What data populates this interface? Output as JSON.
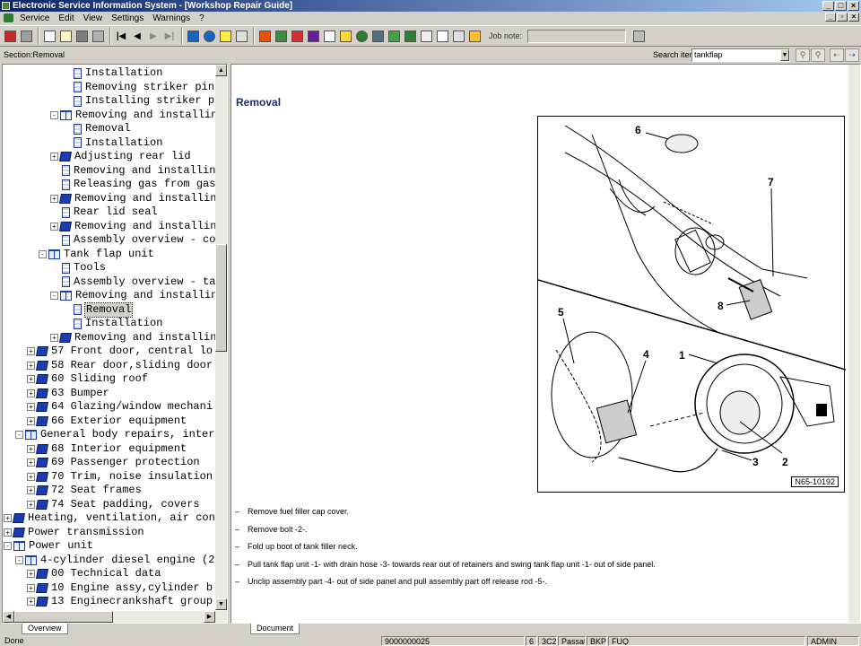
{
  "window": {
    "title": "Electronic Service Information System - [Workshop Repair Guide]"
  },
  "menu": [
    "Service",
    "Edit",
    "View",
    "Settings",
    "Warnings",
    "?"
  ],
  "toolbar": {
    "job_note_label": "Job note:",
    "job_note_value": ""
  },
  "sectionbar": {
    "section_label": "Section:Removal",
    "search_label": "Search item:",
    "search_value": "tankflap"
  },
  "tree": [
    {
      "label": "Installation",
      "icon": "doc",
      "depth": 5
    },
    {
      "label": "Removing striker pin",
      "icon": "doc",
      "depth": 5
    },
    {
      "label": "Installing striker p",
      "icon": "doc",
      "depth": 5
    },
    {
      "label": "Removing and installing",
      "icon": "book-open",
      "depth": 4,
      "expander": "-"
    },
    {
      "label": "Removal",
      "icon": "doc",
      "depth": 5
    },
    {
      "label": "Installation",
      "icon": "doc",
      "depth": 5
    },
    {
      "label": "Adjusting rear lid",
      "icon": "book",
      "depth": 4,
      "expander": "+"
    },
    {
      "label": "Removing and installing",
      "icon": "doc",
      "depth": 4
    },
    {
      "label": "Releasing gas from gas",
      "icon": "doc",
      "depth": 4
    },
    {
      "label": "Removing and installing",
      "icon": "book",
      "depth": 4,
      "expander": "+"
    },
    {
      "label": "Rear lid seal",
      "icon": "doc",
      "depth": 4
    },
    {
      "label": "Removing and installing",
      "icon": "book",
      "depth": 4,
      "expander": "+"
    },
    {
      "label": "Assembly overview - co",
      "icon": "doc",
      "depth": 4
    },
    {
      "label": "Tank flap unit",
      "icon": "book-open",
      "depth": 3,
      "expander": "-"
    },
    {
      "label": "Tools",
      "icon": "doc",
      "depth": 4
    },
    {
      "label": "Assembly overview - ta",
      "icon": "doc",
      "depth": 4
    },
    {
      "label": "Removing and installing",
      "icon": "book-open",
      "depth": 4,
      "expander": "-"
    },
    {
      "label": "Removal",
      "icon": "doc",
      "depth": 5,
      "selected": true
    },
    {
      "label": "Installation",
      "icon": "doc",
      "depth": 5
    },
    {
      "label": "Removing and installing",
      "icon": "book",
      "depth": 4,
      "expander": "+"
    },
    {
      "label": "57 Front door, central lo",
      "icon": "book",
      "depth": 2,
      "expander": "+"
    },
    {
      "label": "58 Rear door,sliding door",
      "icon": "book",
      "depth": 2,
      "expander": "+"
    },
    {
      "label": "60 Sliding roof",
      "icon": "book",
      "depth": 2,
      "expander": "+"
    },
    {
      "label": "63 Bumper",
      "icon": "book",
      "depth": 2,
      "expander": "+"
    },
    {
      "label": "64 Glazing/window mechani",
      "icon": "book",
      "depth": 2,
      "expander": "+"
    },
    {
      "label": "66 Exterior equipment",
      "icon": "book",
      "depth": 2,
      "expander": "+"
    },
    {
      "label": "General body repairs, inter",
      "icon": "book-open",
      "depth": 1,
      "expander": "-"
    },
    {
      "label": "68 Interior equipment",
      "icon": "book",
      "depth": 2,
      "expander": "+"
    },
    {
      "label": "69 Passenger protection",
      "icon": "book",
      "depth": 2,
      "expander": "+"
    },
    {
      "label": "70 Trim, noise insulation",
      "icon": "book",
      "depth": 2,
      "expander": "+"
    },
    {
      "label": "72 Seat frames",
      "icon": "book",
      "depth": 2,
      "expander": "+"
    },
    {
      "label": "74 Seat padding, covers",
      "icon": "book",
      "depth": 2,
      "expander": "+"
    },
    {
      "label": "Heating, ventilation, air con",
      "icon": "book",
      "depth": 0,
      "expander": "+"
    },
    {
      "label": "Power transmission",
      "icon": "book",
      "depth": 0,
      "expander": "+"
    },
    {
      "label": "Power unit",
      "icon": "book-open",
      "depth": 0,
      "expander": "-"
    },
    {
      "label": "4-cylinder diesel engine (2",
      "icon": "book-open",
      "depth": 1,
      "expander": "-"
    },
    {
      "label": "00 Technical data",
      "icon": "book",
      "depth": 2,
      "expander": "+"
    },
    {
      "label": "10 Engine assy,cylinder b",
      "icon": "book",
      "depth": 2,
      "expander": "+"
    },
    {
      "label": "13 Enginecrankshaft group",
      "icon": "book",
      "depth": 2,
      "expander": "+"
    }
  ],
  "tabs": {
    "left": "Overview",
    "right": "Document"
  },
  "document": {
    "title": "Removal",
    "figure_id": "N65-10192",
    "callouts": [
      "6",
      "7",
      "8",
      "5",
      "4",
      "1",
      "2",
      "3"
    ],
    "steps": [
      "Remove fuel filler cap cover.",
      "Remove bolt -2-.",
      "Fold up boot of tank filler neck.",
      "Pull tank flap unit -1- with drain hose -3- towards rear out of retainers and swing tank flap unit -1- out of side panel.",
      "Unclip assembly part -4- out of side panel and pull assembly part off release rod -5-."
    ],
    "step_bullet": "–"
  },
  "status": {
    "left": "Done",
    "id": "9000000025",
    "c1": "6",
    "c2": "3C2",
    "c3": "Passat",
    "c4": "BKP",
    "c5": "FUQ",
    "user": "ADMIN"
  }
}
